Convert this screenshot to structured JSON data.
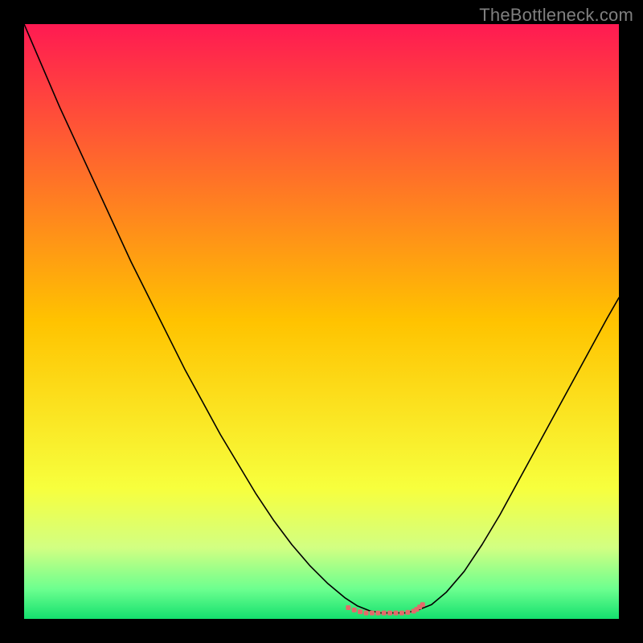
{
  "watermark": {
    "text": "TheBottleneck.com"
  },
  "chart_data": {
    "type": "line",
    "title": "",
    "xlabel": "",
    "ylabel": "",
    "xlim": [
      0,
      100
    ],
    "ylim": [
      0,
      100
    ],
    "gradient_stops": [
      {
        "offset": 0.0,
        "color": "#ff1a52"
      },
      {
        "offset": 0.5,
        "color": "#ffc300"
      },
      {
        "offset": 0.78,
        "color": "#f7ff3d"
      },
      {
        "offset": 0.88,
        "color": "#d2ff82"
      },
      {
        "offset": 0.95,
        "color": "#6cff8f"
      },
      {
        "offset": 1.0,
        "color": "#14e06e"
      }
    ],
    "series": [
      {
        "name": "bottleneck-black",
        "color": "#000000",
        "width": 1.6,
        "x": [
          0.0,
          3.0,
          6.0,
          9.0,
          12.0,
          15.0,
          18.0,
          21.0,
          24.0,
          27.0,
          30.0,
          33.0,
          36.0,
          39.0,
          42.0,
          45.0,
          48.0,
          51.0,
          54.0,
          56.0,
          58.0,
          60.0,
          62.0,
          64.0,
          66.0,
          68.5,
          71.0,
          74.0,
          77.0,
          80.0,
          83.0,
          86.0,
          89.0,
          92.0,
          95.0,
          98.0,
          100.0
        ],
        "y": [
          100.0,
          93.0,
          86.0,
          79.5,
          73.0,
          66.5,
          60.0,
          54.0,
          48.0,
          42.0,
          36.5,
          31.0,
          26.0,
          21.0,
          16.5,
          12.5,
          9.0,
          6.0,
          3.5,
          2.2,
          1.4,
          1.0,
          1.0,
          1.0,
          1.4,
          2.4,
          4.5,
          8.0,
          12.5,
          17.5,
          23.0,
          28.5,
          34.0,
          39.5,
          45.0,
          50.5,
          54.0
        ]
      },
      {
        "name": "bottom-tick-red",
        "color": "#e46a6a",
        "width": 6,
        "x": [
          54.5,
          55.5,
          56.5,
          57.5,
          58.5,
          59.5,
          60.5,
          61.5,
          62.5,
          63.5,
          64.5,
          65.5,
          66.0,
          66.5,
          67.0
        ],
        "y": [
          1.9,
          1.5,
          1.2,
          1.0,
          1.0,
          1.0,
          1.0,
          1.0,
          1.0,
          1.0,
          1.1,
          1.3,
          1.6,
          2.0,
          2.4
        ]
      }
    ]
  }
}
